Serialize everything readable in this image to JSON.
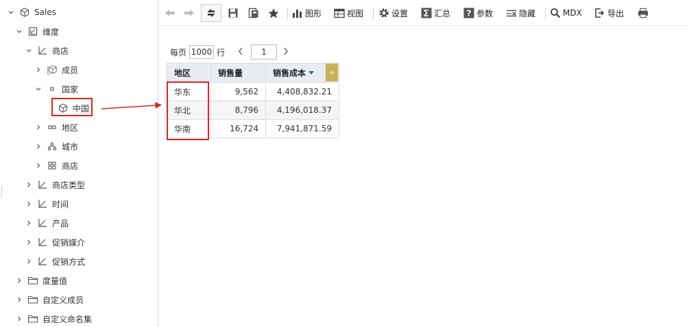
{
  "tree": {
    "root": "Sales",
    "dimension_group": "维度",
    "store_dimension": "商店",
    "members": "成员",
    "country": "国家",
    "china": "中国",
    "region": "地区",
    "city": "城市",
    "store": "商店",
    "store_type": "商店类型",
    "time": "时间",
    "product": "产品",
    "promo_media": "促销媒介",
    "promo_method": "促销方式",
    "measures": "度量值",
    "custom_members": "自定义成员",
    "custom_named_sets": "自定义命名集"
  },
  "toolbar": {
    "chart": "图形",
    "view": "视图",
    "settings": "设置",
    "summary": "汇总",
    "params": "参数",
    "hide": "隐藏",
    "mdx": "MDX",
    "export": "导出"
  },
  "pager": {
    "per_page": "每页",
    "rows_value": "1000",
    "rows_unit": "行",
    "page_value": "1"
  },
  "table": {
    "headers": [
      "地区",
      "销售量",
      "销售成本"
    ],
    "rows": [
      [
        "华东",
        "9,562",
        "4,408,832.21"
      ],
      [
        "华北",
        "8,796",
        "4,196,018.37"
      ],
      [
        "华南",
        "16,724",
        "7,941,871.59"
      ]
    ]
  },
  "colors": {
    "highlight": "#e02020",
    "header_bg": "#e9edf1",
    "sort_indicator": "#1f6fb2",
    "column_handle": "#c9b15a"
  }
}
